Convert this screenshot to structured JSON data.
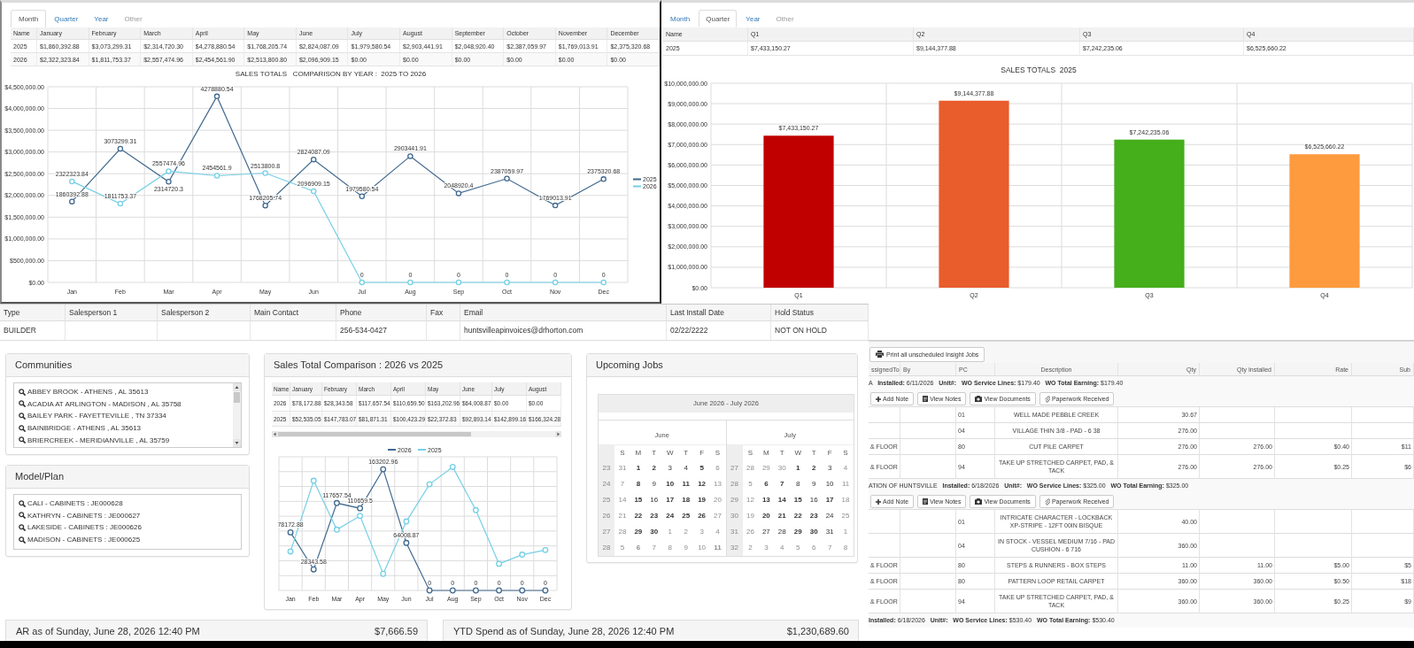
{
  "month_panel": {
    "tabs": [
      {
        "label": "Month",
        "selected": true,
        "disabled": false
      },
      {
        "label": "Quarter",
        "selected": false,
        "disabled": false
      },
      {
        "label": "Year",
        "selected": false,
        "disabled": false
      },
      {
        "label": "Other",
        "selected": false,
        "disabled": true
      }
    ],
    "table": {
      "columns": [
        "Name",
        "January",
        "February",
        "March",
        "April",
        "May",
        "June",
        "July",
        "August",
        "September",
        "October",
        "November",
        "December"
      ],
      "rows": [
        [
          "2025",
          "$1,860,392.88",
          "$3,073,299.31",
          "$2,314,720.30",
          "$4,278,880.54",
          "$1,768,205.74",
          "$2,824,087.09",
          "$1,979,580.54",
          "$2,903,441.91",
          "$2,048,920.40",
          "$2,387,059.97",
          "$1,769,013.91",
          "$2,375,320.68"
        ],
        [
          "2026",
          "$2,322,323.84",
          "$1,811,753.37",
          "$2,557,474.96",
          "$2,454,561.90",
          "$2,513,800.80",
          "$2,096,909.15",
          "$0.00",
          "$0.00",
          "$0.00",
          "$0.00",
          "$0.00",
          "$0.00"
        ]
      ]
    },
    "chart_data": {
      "type": "line",
      "title": "SALES TOTALS   COMPARISON BY YEAR :  2025 TO 2026",
      "categories": [
        "Jan",
        "Feb",
        "Mar",
        "Apr",
        "May",
        "Jun",
        "Jul",
        "Aug",
        "Sep",
        "Oct",
        "Nov",
        "Dec"
      ],
      "series": [
        {
          "name": "2025",
          "color": "#41698f",
          "marker": "circle",
          "values": [
            1860392.88,
            3073299.31,
            2314720.3,
            4278880.54,
            1768205.74,
            2824087.09,
            1979580.54,
            2903441.91,
            2048920.4,
            2387059.97,
            1769013.91,
            2375320.68
          ]
        },
        {
          "name": "2026",
          "color": "#75cfe6",
          "marker": "circle",
          "values": [
            2322323.84,
            1811753.37,
            2557474.96,
            2454561.9,
            2513800.8,
            2096909.15,
            0,
            0,
            0,
            0,
            0,
            0
          ]
        }
      ],
      "ylim": [
        0,
        4500000
      ],
      "yticks": [
        {
          "value": 0,
          "label": "$0.00"
        },
        {
          "value": 500000,
          "label": "$500,000.00"
        },
        {
          "value": 1000000,
          "label": "$1,000,000.00"
        },
        {
          "value": 1500000,
          "label": "$1,500,000.00"
        },
        {
          "value": 2000000,
          "label": "$2,000,000.00"
        },
        {
          "value": 2500000,
          "label": "$2,500,000.00"
        },
        {
          "value": 3000000,
          "label": "$3,000,000.00"
        },
        {
          "value": 3500000,
          "label": "$3,500,000.00"
        },
        {
          "value": 4000000,
          "label": "$4,000,000.00"
        },
        {
          "value": 4500000,
          "label": "$4,500,000.00"
        }
      ],
      "grid": true,
      "legend": "right",
      "data_labels": true
    }
  },
  "quarter_panel": {
    "tabs": [
      {
        "label": "Month",
        "selected": false,
        "disabled": false
      },
      {
        "label": "Quarter",
        "selected": true,
        "disabled": false
      },
      {
        "label": "Year",
        "selected": false,
        "disabled": false
      },
      {
        "label": "Other",
        "selected": false,
        "disabled": true
      }
    ],
    "table": {
      "columns": [
        "Name",
        "Q1",
        "Q2",
        "Q3",
        "Q4"
      ],
      "rows": [
        [
          "2025",
          "$7,433,150.27",
          "$9,144,377.88",
          "$7,242,235.06",
          "$6,525,660.22"
        ]
      ]
    },
    "chart_data": {
      "type": "bar",
      "title": "SALES TOTALS  2025",
      "categories": [
        "Q1",
        "Q2",
        "Q3",
        "Q4"
      ],
      "values": [
        7433150.27,
        9144377.88,
        7242235.06,
        6525660.22
      ],
      "colors": [
        "#c00000",
        "#e95c2c",
        "#45ae1b",
        "#fd9b3e"
      ],
      "value_labels": [
        "$7,433,150.27",
        "$9,144,377.88",
        "$7,242,235.06",
        "$6,525,660.22"
      ],
      "ylim": [
        0,
        10000000
      ],
      "yticks": [
        {
          "value": 0,
          "label": "$0.00"
        },
        {
          "value": 1000000,
          "label": "$1,000,000.00"
        },
        {
          "value": 2000000,
          "label": "$2,000,000.00"
        },
        {
          "value": 3000000,
          "label": "$3,000,000.00"
        },
        {
          "value": 4000000,
          "label": "$4,000,000.00"
        },
        {
          "value": 5000000,
          "label": "$5,000,000.00"
        },
        {
          "value": 6000000,
          "label": "$6,000,000.00"
        },
        {
          "value": 7000000,
          "label": "$7,000,000.00"
        },
        {
          "value": 8000000,
          "label": "$8,000,000.00"
        },
        {
          "value": 9000000,
          "label": "$9,000,000.00"
        },
        {
          "value": 10000000,
          "label": "$10,000,000.00"
        }
      ],
      "grid": true
    }
  },
  "account": {
    "columns": [
      "Type",
      "Salesperson 1",
      "Salesperson 2",
      "Main Contact",
      "Phone",
      "Fax",
      "Email",
      "Last Install Date",
      "Hold Status"
    ],
    "rows": [
      [
        "BUILDER",
        null,
        null,
        null,
        "256-534-0427",
        null,
        "huntsvilleapinvoices@drhorton.com",
        "02/22/2222",
        "NOT ON HOLD"
      ]
    ]
  },
  "communities": {
    "title": "Communities",
    "items": [
      "ABBEY BROOK - ATHENS , AL 35613",
      "ACADIA AT ARLINGTON - MADISON , AL 35758",
      "BAILEY PARK - FAYETTEVILLE , TN 37334",
      "BAINBRIDGE - ATHENS , AL 35613",
      "BRIERCREEK - MERIDIANVILLE , AL 35759"
    ]
  },
  "model_plan": {
    "title": "Model/Plan",
    "items": [
      "CALI - CABINETS : JE000628",
      "KATHRYN - CABINETS : JE000627",
      "LAKESIDE - CABINETS : JE000626",
      "MADISON - CABINETS : JE000625"
    ]
  },
  "sales_comparison": {
    "title": "Sales Total Comparison : 2026 vs 2025",
    "table": {
      "columns": [
        "Name",
        "January",
        "February",
        "March",
        "April",
        "May",
        "June",
        "July",
        "August"
      ],
      "rows": [
        [
          "2026",
          "$78,172.88",
          "$28,343.58",
          "$117,657.54",
          "$110,659.50",
          "$163,202.96",
          "$64,008.87",
          "$0.00",
          "$0.00"
        ],
        [
          "2025",
          "$52,535.05",
          "$147,783.07",
          "$81,871.31",
          "$100,423.29",
          "$22,372.83",
          "$92,893.14",
          "$142,899.16",
          "$166,324.28"
        ]
      ]
    },
    "chart_data": {
      "type": "line",
      "categories": [
        "Jan",
        "Feb",
        "Mar",
        "Apr",
        "May",
        "Jun",
        "Jul",
        "Aug",
        "Sep",
        "Oct",
        "Nov",
        "Dec"
      ],
      "series": [
        {
          "name": "2026",
          "color": "#41698f",
          "marker": "circle",
          "values": [
            78172.88,
            28343.58,
            117657.54,
            110659.5,
            163202.96,
            64008.87,
            0,
            0,
            0,
            0,
            0,
            0
          ],
          "data_labels": true
        },
        {
          "name": "2025",
          "color": "#75cfe6",
          "marker": "circle",
          "values": [
            52535.05,
            147783.07,
            81871.31,
            100423.29,
            22372.83,
            92893.14,
            142899.16,
            166324.28,
            108100,
            35900,
            48200,
            54400
          ],
          "data_labels": false
        }
      ],
      "ylim": [
        0,
        180000
      ],
      "grid": true,
      "legend": "top"
    }
  },
  "upcoming_jobs": {
    "title": "Upcoming Jobs",
    "calendar": {
      "range": "June 2026 - July 2026",
      "months": [
        {
          "name": "June",
          "weekdays": [
            "S",
            "M",
            "T",
            "W",
            "T",
            "F",
            "S"
          ],
          "weeks": [
            {
              "number": "23",
              "days": [
                {
                  "day": "31",
                  "dimmed": true,
                  "has_jobs": false
                },
                {
                  "day": "1",
                  "dimmed": false,
                  "has_jobs": true
                },
                {
                  "day": "2",
                  "dimmed": false,
                  "has_jobs": true
                },
                {
                  "day": "3",
                  "dimmed": false,
                  "has_jobs": false
                },
                {
                  "day": "4",
                  "dimmed": false,
                  "has_jobs": false
                },
                {
                  "day": "5",
                  "dimmed": false,
                  "has_jobs": true
                },
                {
                  "day": "6",
                  "dimmed": true,
                  "has_jobs": false
                }
              ]
            },
            {
              "number": "24",
              "days": [
                {
                  "day": "7",
                  "dimmed": true,
                  "has_jobs": false
                },
                {
                  "day": "8",
                  "dimmed": false,
                  "has_jobs": true
                },
                {
                  "day": "9",
                  "dimmed": false,
                  "has_jobs": false
                },
                {
                  "day": "10",
                  "dimmed": false,
                  "has_jobs": true
                },
                {
                  "day": "11",
                  "dimmed": false,
                  "has_jobs": true
                },
                {
                  "day": "12",
                  "dimmed": false,
                  "has_jobs": true
                },
                {
                  "day": "13",
                  "dimmed": true,
                  "has_jobs": false
                }
              ]
            },
            {
              "number": "25",
              "days": [
                {
                  "day": "14",
                  "dimmed": true,
                  "has_jobs": false
                },
                {
                  "day": "15",
                  "dimmed": false,
                  "has_jobs": true
                },
                {
                  "day": "16",
                  "dimmed": false,
                  "has_jobs": false
                },
                {
                  "day": "17",
                  "dimmed": false,
                  "has_jobs": true
                },
                {
                  "day": "18",
                  "dimmed": false,
                  "has_jobs": true
                },
                {
                  "day": "19",
                  "dimmed": false,
                  "has_jobs": true
                },
                {
                  "day": "20",
                  "dimmed": true,
                  "has_jobs": false
                }
              ]
            },
            {
              "number": "26",
              "days": [
                {
                  "day": "21",
                  "dimmed": true,
                  "has_jobs": false
                },
                {
                  "day": "22",
                  "dimmed": false,
                  "has_jobs": true
                },
                {
                  "day": "23",
                  "dimmed": false,
                  "has_jobs": true
                },
                {
                  "day": "24",
                  "dimmed": false,
                  "has_jobs": true
                },
                {
                  "day": "25",
                  "dimmed": false,
                  "has_jobs": true
                },
                {
                  "day": "26",
                  "dimmed": false,
                  "has_jobs": true
                },
                {
                  "day": "27",
                  "dimmed": true,
                  "has_jobs": false
                }
              ]
            },
            {
              "number": "27",
              "days": [
                {
                  "day": "28",
                  "dimmed": true,
                  "has_jobs": false
                },
                {
                  "day": "29",
                  "dimmed": false,
                  "has_jobs": true
                },
                {
                  "day": "30",
                  "dimmed": false,
                  "has_jobs": true
                },
                {
                  "day": "1",
                  "dimmed": true,
                  "has_jobs": false
                },
                {
                  "day": "2",
                  "dimmed": true,
                  "has_jobs": false
                },
                {
                  "day": "3",
                  "dimmed": true,
                  "has_jobs": false
                },
                {
                  "day": "4",
                  "dimmed": true,
                  "has_jobs": false
                }
              ]
            },
            {
              "number": "28",
              "days": [
                {
                  "day": "5",
                  "dimmed": true,
                  "has_jobs": false
                },
                {
                  "day": "6",
                  "dimmed": true,
                  "has_jobs": true
                },
                {
                  "day": "7",
                  "dimmed": true,
                  "has_jobs": false
                },
                {
                  "day": "8",
                  "dimmed": true,
                  "has_jobs": false
                },
                {
                  "day": "9",
                  "dimmed": true,
                  "has_jobs": false
                },
                {
                  "day": "10",
                  "dimmed": true,
                  "has_jobs": false
                },
                {
                  "day": "11",
                  "dimmed": true,
                  "has_jobs": true
                }
              ]
            }
          ]
        },
        {
          "name": "July",
          "weekdays": [
            "S",
            "M",
            "T",
            "W",
            "T",
            "F",
            "S"
          ],
          "weeks": [
            {
              "number": "27",
              "days": [
                {
                  "day": "28",
                  "dimmed": true,
                  "has_jobs": false
                },
                {
                  "day": "29",
                  "dimmed": true,
                  "has_jobs": false
                },
                {
                  "day": "30",
                  "dimmed": true,
                  "has_jobs": false
                },
                {
                  "day": "1",
                  "dimmed": false,
                  "has_jobs": true
                },
                {
                  "day": "2",
                  "dimmed": false,
                  "has_jobs": true
                },
                {
                  "day": "3",
                  "dimmed": false,
                  "has_jobs": false
                },
                {
                  "day": "4",
                  "dimmed": true,
                  "has_jobs": false
                }
              ]
            },
            {
              "number": "28",
              "days": [
                {
                  "day": "5",
                  "dimmed": true,
                  "has_jobs": false
                },
                {
                  "day": "6",
                  "dimmed": false,
                  "has_jobs": true
                },
                {
                  "day": "7",
                  "dimmed": false,
                  "has_jobs": true
                },
                {
                  "day": "8",
                  "dimmed": false,
                  "has_jobs": false
                },
                {
                  "day": "9",
                  "dimmed": false,
                  "has_jobs": false
                },
                {
                  "day": "10",
                  "dimmed": false,
                  "has_jobs": false
                },
                {
                  "day": "11",
                  "dimmed": true,
                  "has_jobs": false
                }
              ]
            },
            {
              "number": "29",
              "days": [
                {
                  "day": "12",
                  "dimmed": true,
                  "has_jobs": false
                },
                {
                  "day": "13",
                  "dimmed": false,
                  "has_jobs": true
                },
                {
                  "day": "14",
                  "dimmed": false,
                  "has_jobs": true
                },
                {
                  "day": "15",
                  "dimmed": false,
                  "has_jobs": true
                },
                {
                  "day": "16",
                  "dimmed": false,
                  "has_jobs": false
                },
                {
                  "day": "17",
                  "dimmed": false,
                  "has_jobs": true
                },
                {
                  "day": "18",
                  "dimmed": true,
                  "has_jobs": false
                }
              ]
            },
            {
              "number": "30",
              "days": [
                {
                  "day": "19",
                  "dimmed": true,
                  "has_jobs": false
                },
                {
                  "day": "20",
                  "dimmed": false,
                  "has_jobs": true
                },
                {
                  "day": "21",
                  "dimmed": false,
                  "has_jobs": true
                },
                {
                  "day": "22",
                  "dimmed": false,
                  "has_jobs": true
                },
                {
                  "day": "23",
                  "dimmed": false,
                  "has_jobs": true
                },
                {
                  "day": "24",
                  "dimmed": false,
                  "has_jobs": false
                },
                {
                  "day": "25",
                  "dimmed": true,
                  "has_jobs": false
                }
              ]
            },
            {
              "number": "31",
              "days": [
                {
                  "day": "26",
                  "dimmed": true,
                  "has_jobs": false
                },
                {
                  "day": "27",
                  "dimmed": false,
                  "has_jobs": false
                },
                {
                  "day": "28",
                  "dimmed": false,
                  "has_jobs": false
                },
                {
                  "day": "29",
                  "dimmed": false,
                  "has_jobs": true
                },
                {
                  "day": "30",
                  "dimmed": false,
                  "has_jobs": true
                },
                {
                  "day": "31",
                  "dimmed": false,
                  "has_jobs": false
                },
                {
                  "day": "1",
                  "dimmed": true,
                  "has_jobs": false
                }
              ]
            },
            {
              "number": "32",
              "days": [
                {
                  "day": "2",
                  "dimmed": true,
                  "has_jobs": false
                },
                {
                  "day": "3",
                  "dimmed": true,
                  "has_jobs": false
                },
                {
                  "day": "4",
                  "dimmed": true,
                  "has_jobs": false
                },
                {
                  "day": "5",
                  "dimmed": true,
                  "has_jobs": false
                },
                {
                  "day": "6",
                  "dimmed": true,
                  "has_jobs": false
                },
                {
                  "day": "7",
                  "dimmed": true,
                  "has_jobs": false
                },
                {
                  "day": "8",
                  "dimmed": true,
                  "has_jobs": false
                }
              ]
            }
          ]
        }
      ]
    }
  },
  "summaries": [
    {
      "label": "AR as of Sunday, June 28, 2026 12:40 PM",
      "amount": "$7,666.59"
    },
    {
      "label": "YTD Spend as of Sunday, June 28, 2026 12:40 PM",
      "amount": "$1,230,689.60"
    }
  ],
  "jobs": {
    "print_button": "Print all unscheduled Insight Jobs",
    "columns": [
      {
        "label": "ssignedTo",
        "kind": "text"
      },
      {
        "label": "By",
        "kind": "text"
      },
      {
        "label": "PC",
        "kind": "code"
      },
      {
        "label": "Description",
        "kind": "description"
      },
      {
        "label": "Qty",
        "kind": "number"
      },
      {
        "label": "Qty Installed",
        "kind": "number"
      },
      {
        "label": "Rate",
        "kind": "number"
      },
      {
        "label": "Sub",
        "kind": "number"
      }
    ],
    "groups": [
      {
        "header": "A   **Installed:** 6/11/2026   **Unit#:**   **WO Service Lines:** $179.40   **WO Total Earning:** $179.40",
        "actions": [
          {
            "label": "Add Note",
            "kind": "add"
          },
          {
            "label": "View Notes",
            "kind": "notes"
          },
          {
            "label": "View Documents",
            "kind": "documents"
          },
          {
            "label": "Paperwork Received",
            "kind": "paperwork"
          }
        ],
        "rows": [
          [
            null,
            null,
            "01",
            "WELL MADE PEBBLE CREEK",
            "30.67",
            null,
            null,
            null
          ],
          [
            null,
            null,
            "04",
            "VILLAGE THIN 3/8 - PAD - 6 38",
            "276.00",
            null,
            null,
            null
          ],
          [
            "& FLOOR",
            null,
            "80",
            "CUT PILE CARPET",
            "276.00",
            "276.00",
            "$0.40",
            "$11"
          ],
          [
            "& FLOOR",
            null,
            "94",
            "TAKE UP STRETCHED CARPET, PAD, & TACK",
            "276.00",
            "276.00",
            "$0.25",
            "$6"
          ]
        ]
      },
      {
        "header": "ATION OF HUNTSVILLE   **Installed:** 6/18/2026   **Unit#:**   **WO Service Lines:** $325.00   **WO Total Earning:** $325.00",
        "actions": [
          {
            "label": "Add Note",
            "kind": "add"
          },
          {
            "label": "View Notes",
            "kind": "notes"
          },
          {
            "label": "View Documents",
            "kind": "documents"
          },
          {
            "label": "Paperwork Received",
            "kind": "paperwork"
          }
        ],
        "rows": [
          [
            null,
            null,
            "01",
            "INTRICATE CHARACTER - LOCKBACK XP-STRIPE - 12FT 00IN BISQUE",
            "40.00",
            null,
            null,
            null
          ],
          [
            null,
            null,
            "04",
            "IN STOCK - VESSEL MEDIUM 7/16 - PAD CUSHION - 6 716",
            "360.00",
            null,
            null,
            null
          ],
          [
            "& FLOOR",
            null,
            "80",
            "STEPS & RUNNERS - BOX STEPS",
            "11.00",
            "11.00",
            "$5.00",
            "$5"
          ],
          [
            "& FLOOR",
            null,
            "80",
            "PATTERN LOOP RETAIL CARPET",
            "360.00",
            "360.00",
            "$0.50",
            "$18"
          ],
          [
            "& FLOOR",
            null,
            "94",
            "TAKE UP STRETCHED CARPET, PAD, & TACK",
            "360.00",
            "360.00",
            "$0.25",
            "$9"
          ]
        ]
      },
      {
        "header": "**Installed:** 6/18/2026   **Unit#:**   **WO Service Lines:** $530.40   **WO Total Earning:** $530.40"
      }
    ]
  }
}
